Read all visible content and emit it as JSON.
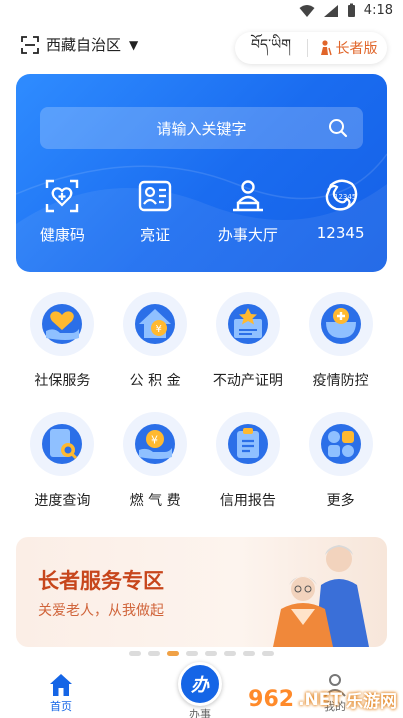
{
  "status": {
    "time": "4:18"
  },
  "header": {
    "location": "西藏自治区",
    "tibetan_label": "བོད་ཡིག",
    "elder_label": "长者版"
  },
  "hero": {
    "search_placeholder": "请输入关键字",
    "quick": [
      {
        "label": "健康码",
        "icon": "health-code-icon"
      },
      {
        "label": "亮证",
        "icon": "id-card-icon"
      },
      {
        "label": "办事大厅",
        "icon": "service-hall-icon"
      },
      {
        "label": "12345",
        "icon": "hotline-12345-icon"
      }
    ]
  },
  "services": [
    {
      "label": "社保服务",
      "icon": "social-security-icon"
    },
    {
      "label": "公 积 金",
      "icon": "housing-fund-icon"
    },
    {
      "label": "不动产证明",
      "icon": "real-estate-icon"
    },
    {
      "label": "疫情防控",
      "icon": "epidemic-control-icon"
    },
    {
      "label": "进度查询",
      "icon": "progress-query-icon"
    },
    {
      "label": "燃 气 费",
      "icon": "gas-fee-icon"
    },
    {
      "label": "信用报告",
      "icon": "credit-report-icon"
    },
    {
      "label": "更多",
      "icon": "more-icon"
    }
  ],
  "banner": {
    "title": "长者服务专区",
    "subtitle": "关爱老人，从我做起"
  },
  "carousel": {
    "count": 8,
    "active_index": 2
  },
  "tabbar": {
    "home": "首页",
    "work": "办事",
    "work_icon_text": "办",
    "mine": "我的"
  },
  "watermark": {
    "num": "962",
    "text": "乐游网",
    "suffix": ".NET"
  },
  "colors": {
    "primary": "#1565e6",
    "accent": "#e0652a"
  }
}
